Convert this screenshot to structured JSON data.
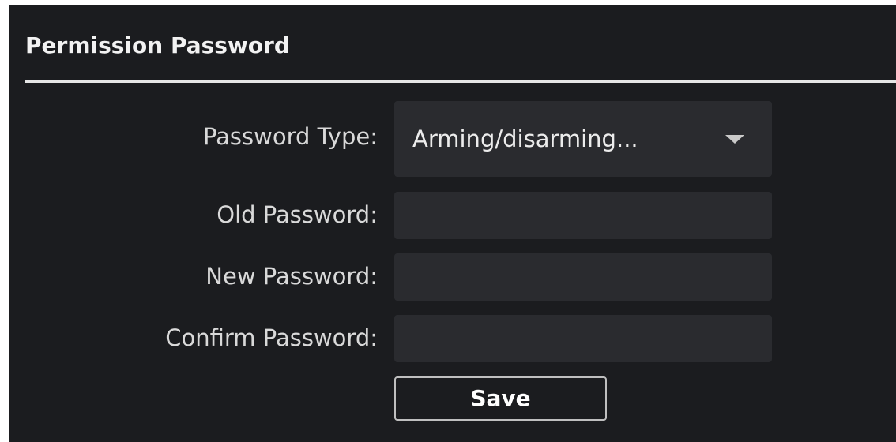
{
  "section": {
    "title": "Permission Password"
  },
  "form": {
    "password_type_label": "Password Type:",
    "password_type_value": "Arming/disarming...",
    "old_password_label": "Old Password:",
    "old_password_value": "",
    "new_password_label": "New Password:",
    "new_password_value": "",
    "confirm_password_label": "Confirm Password:",
    "confirm_password_value": "",
    "save_label": "Save"
  },
  "icons": {
    "dropdown": "chevron-down-icon"
  },
  "colors": {
    "panel_bg": "#1b1c1f",
    "field_bg": "#2a2b2f",
    "text": "#d9d9d9",
    "divider": "#e6e6e6"
  }
}
